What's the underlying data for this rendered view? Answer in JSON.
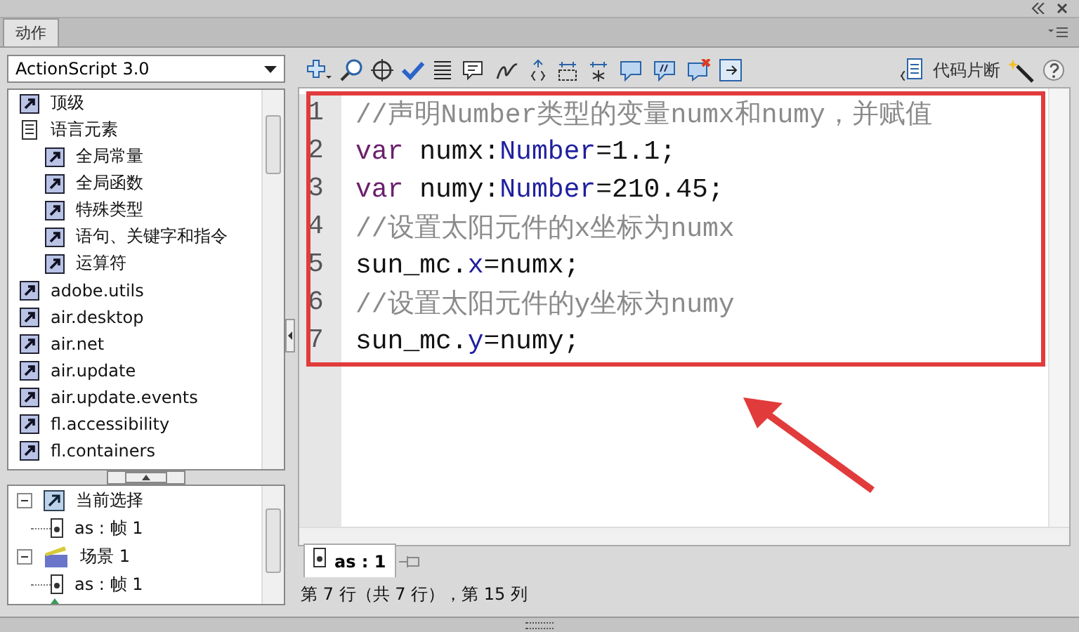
{
  "panel_tab": "动作",
  "language_select": {
    "value": "ActionScript 3.0"
  },
  "code_snippets_label": "代码片断",
  "toolbox": [
    {
      "label": "顶级",
      "kind": "item"
    },
    {
      "label": "语言元素",
      "kind": "book",
      "children": [
        {
          "label": "全局常量",
          "kind": "item"
        },
        {
          "label": "全局函数",
          "kind": "item"
        },
        {
          "label": "特殊类型",
          "kind": "item"
        },
        {
          "label": "语句、关键字和指令",
          "kind": "item"
        },
        {
          "label": "运算符",
          "kind": "item"
        }
      ]
    },
    {
      "label": "adobe.utils",
      "kind": "item"
    },
    {
      "label": "air.desktop",
      "kind": "item"
    },
    {
      "label": "air.net",
      "kind": "item"
    },
    {
      "label": "air.update",
      "kind": "item"
    },
    {
      "label": "air.update.events",
      "kind": "item"
    },
    {
      "label": "fl.accessibility",
      "kind": "item"
    },
    {
      "label": "fl.containers",
      "kind": "item"
    }
  ],
  "script_tree": [
    {
      "label": "当前选择",
      "kind": "selection",
      "expanded": true,
      "children": [
        {
          "label": "as : 帧 1",
          "kind": "frame"
        }
      ]
    },
    {
      "label": "场景 1",
      "kind": "scene",
      "expanded": true,
      "children": [
        {
          "label": "as : 帧 1",
          "kind": "frame"
        }
      ]
    }
  ],
  "code_lines": [
    {
      "number": "1",
      "tokens": [
        {
          "kind": "comment",
          "text": "//声明Number类型的变量numx和numy，并赋值"
        }
      ]
    },
    {
      "number": "2",
      "tokens": [
        {
          "kind": "keyword",
          "text": "var"
        },
        {
          "kind": "plain",
          "text": " numx:"
        },
        {
          "kind": "type",
          "text": "Number"
        },
        {
          "kind": "plain",
          "text": "=1.1;"
        }
      ]
    },
    {
      "number": "3",
      "tokens": [
        {
          "kind": "keyword",
          "text": "var"
        },
        {
          "kind": "plain",
          "text": " numy:"
        },
        {
          "kind": "type",
          "text": "Number"
        },
        {
          "kind": "plain",
          "text": "=210.45;"
        }
      ]
    },
    {
      "number": "4",
      "tokens": [
        {
          "kind": "comment",
          "text": "//设置太阳元件的x坐标为numx"
        }
      ]
    },
    {
      "number": "5",
      "tokens": [
        {
          "kind": "plain",
          "text": "sun_mc."
        },
        {
          "kind": "type",
          "text": "x"
        },
        {
          "kind": "plain",
          "text": "=numx;"
        }
      ]
    },
    {
      "number": "6",
      "tokens": [
        {
          "kind": "comment",
          "text": "//设置太阳元件的y坐标为numy"
        }
      ]
    },
    {
      "number": "7",
      "tokens": [
        {
          "kind": "plain",
          "text": "sun_mc."
        },
        {
          "kind": "type",
          "text": "y"
        },
        {
          "kind": "plain",
          "text": "=numy;"
        }
      ]
    }
  ],
  "script_tabs": [
    {
      "label": "as : 1",
      "selected": true
    }
  ],
  "status_bar": "第 7 行（共 7 行），第 15 列"
}
